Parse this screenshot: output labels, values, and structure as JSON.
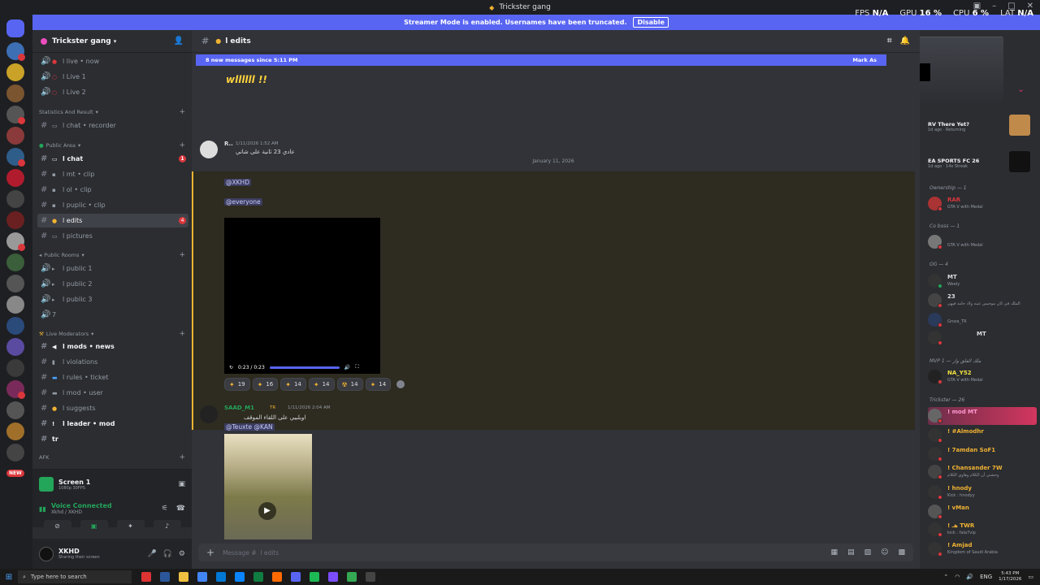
{
  "window": {
    "title": "Trickster gang"
  },
  "perf": {
    "fps_label": "FPS",
    "fps": "N/A",
    "gpu_label": "GPU",
    "gpu": "16 %",
    "cpu_label": "CPU",
    "cpu": "6 %",
    "lat_label": "LAT",
    "lat": "N/A"
  },
  "streamer_banner": {
    "text": "Streamer Mode is enabled. Usernames have been truncated.",
    "disable": "Disable"
  },
  "rail": {
    "new_label": "NEW"
  },
  "guild": {
    "name": "Trickster gang",
    "categories": [
      {
        "name": "Statistics And Result"
      },
      {
        "name": "Public Area"
      },
      {
        "name": "Public Rooms"
      },
      {
        "name": "Live Moderators"
      },
      {
        "name": "AFK"
      }
    ],
    "channels": [
      {
        "name": "l live • now",
        "type": "voice"
      },
      {
        "name": "l Live 1",
        "type": "voice"
      },
      {
        "name": "l Live 2",
        "type": "voice"
      },
      {
        "name": "l chat • recorder",
        "type": "text"
      },
      {
        "name": "l chat",
        "type": "text",
        "mention": "1"
      },
      {
        "name": "l mt • clip",
        "type": "text"
      },
      {
        "name": "l ol • clip",
        "type": "text"
      },
      {
        "name": "l puplic • clip",
        "type": "text"
      },
      {
        "name": "l edits",
        "type": "text",
        "mention": "4"
      },
      {
        "name": "l pictures",
        "type": "text"
      },
      {
        "name": "l public 1",
        "type": "voice"
      },
      {
        "name": "l public 2",
        "type": "voice"
      },
      {
        "name": "l public 3",
        "type": "voice"
      },
      {
        "name": "7",
        "type": "voice"
      },
      {
        "name": "l mods • news",
        "type": "text"
      },
      {
        "name": "l violations",
        "type": "text"
      },
      {
        "name": "l rules • ticket",
        "type": "text"
      },
      {
        "name": "l mod • user",
        "type": "text"
      },
      {
        "name": "l suggests",
        "type": "text"
      },
      {
        "name": "l leader • mod",
        "type": "text"
      },
      {
        "name": "tr",
        "type": "text"
      }
    ]
  },
  "voice": {
    "screen_title": "Screen 1",
    "screen_sub": "1080p 30FPS",
    "status": "Voice Connected",
    "status_sub": "Xkhd / XKHD"
  },
  "user": {
    "name": "XKHD",
    "status": "Sharing their screen"
  },
  "channel": {
    "name": "l edits",
    "new_messages": "8 new messages since 5:11 PM",
    "mark_read": "Mark As",
    "prev_attachment": "wllllll !!",
    "date_divider": "January 11, 2026",
    "composer_placeholder": "Message #  l edits"
  },
  "messages": [
    {
      "author": "R..",
      "time": "1/11/2026 1:52 AM",
      "text": "عادي 23 ثانية على شاني",
      "mentions": [
        "@XKHD",
        "@everyone"
      ],
      "video_time": "0:23 / 0:23",
      "reactions": [
        "19",
        "16",
        "14",
        "14",
        "14",
        "14"
      ]
    },
    {
      "author": "SAAD_M1",
      "tag": "TR",
      "time": "1/11/2026 2:04 AM",
      "text": "اوبلبيي على اللقاء الموقف",
      "mentions": "@Teuxte @KAN"
    }
  ],
  "members": {
    "activities": [
      {
        "title": "RV There Yet?",
        "sub": "1d ago · Returning"
      },
      {
        "title": "EA SPORTS FC 26",
        "sub": "1d ago · 14x Streak"
      }
    ],
    "roles": [
      {
        "label": "Ownership — 1"
      },
      {
        "label": "Co boss — 1"
      },
      {
        "label": "OG — 4"
      },
      {
        "label": "MVP ملك الفلق وار — 1"
      },
      {
        "label": "Trickster — 26"
      }
    ],
    "people": [
      {
        "name": "RAR",
        "activity": "GTA V with Medal"
      },
      {
        "name": "",
        "activity": "GTA V with Medal"
      },
      {
        "name": "MT",
        "activity": "Weely"
      },
      {
        "name": "23",
        "activity": "الملك في كان موجيس عيبه ولاد حامد فيهي"
      },
      {
        "name": "",
        "activity": "Groza_TR"
      },
      {
        "name": "MT",
        "activity": ""
      },
      {
        "name": "NA_Y52",
        "activity": "GTA V with Medal"
      },
      {
        "name": "! mod MT",
        "activity": ""
      },
      {
        "name": "! #Almodhr",
        "activity": ""
      },
      {
        "name": "! 7amdan SoF1",
        "activity": ""
      },
      {
        "name": "! Chansander 7W",
        "activity": "وحشني أن الكلام وهاوي الكلام"
      },
      {
        "name": "! hnody",
        "activity": "Kick : hnodyy"
      },
      {
        "name": "! vMan",
        "activity": ""
      },
      {
        "name": "! هـ TWR",
        "activity": "kick : fala7vip"
      },
      {
        "name": "! Amjad",
        "activity": "Kingdom of Saudi Arabia"
      }
    ]
  },
  "taskbar": {
    "search": "Type here to search",
    "lang": "ENG",
    "time": "5:43 PM",
    "date": "1/17/2026"
  },
  "colors": {
    "blurple": "#5865f2",
    "green": "#23a55a",
    "red": "#da373c",
    "gold": "#f0b232"
  }
}
